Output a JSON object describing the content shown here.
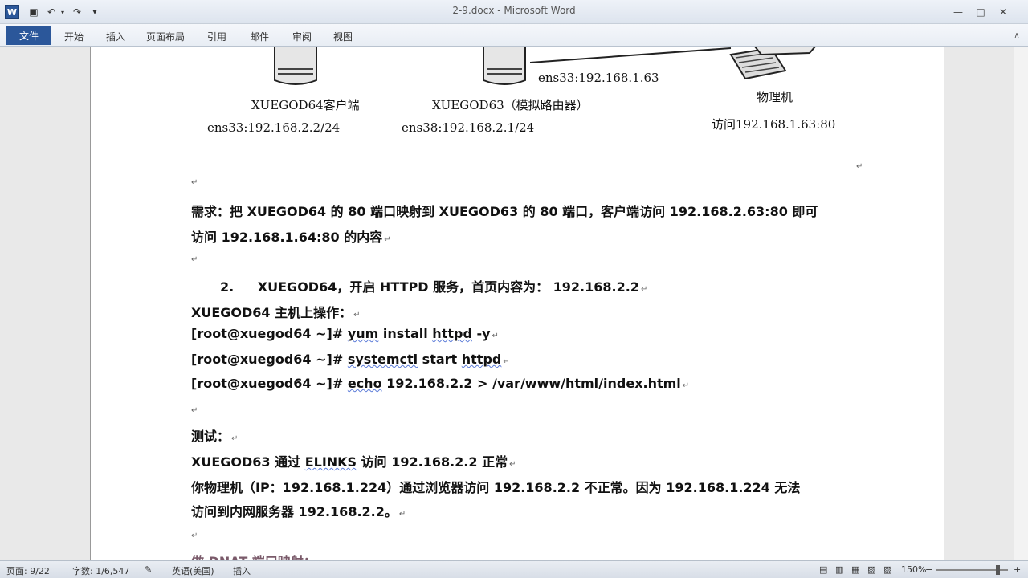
{
  "window": {
    "title": "2-9.docx - Microsoft Word",
    "app_icon_letter": "W"
  },
  "quick_access": {
    "save": "▣",
    "undo": "↶",
    "undo_dropdown": "▾",
    "redo": "↷",
    "customize": "▾"
  },
  "window_controls": {
    "minimize": "—",
    "maximize": "□",
    "close": "✕"
  },
  "ribbon": {
    "tabs": [
      "文件",
      "开始",
      "插入",
      "页面布局",
      "引用",
      "邮件",
      "审阅",
      "视图"
    ]
  },
  "diagram": {
    "client_label": "XUEGOD64客户端",
    "client_ip": "ens33:192.168.2.2/24",
    "router_label": "XUEGOD63（模拟路由器）",
    "router_ip_inner": "ens38:192.168.2.1/24",
    "router_ip_outer": "ens33:192.168.1.63",
    "physical_label": "物理机",
    "physical_access": "访问192.168.1.63:80"
  },
  "content": {
    "req_line1": "需求：把 XUEGOD64 的 80 端口映射到 XUEGOD63 的 80 端口，客户端访问 192.168.2.63:80  即可",
    "req_line2": "访问 192.168.1.64:80 的内容",
    "step2_num": "2.",
    "step2_text": "XUEGOD64，开启 HTTPD 服务，首页内容为：  192.168.2.2",
    "op_title": "XUEGOD64 主机上操作：",
    "cmd1_prompt": "[root@xuegod64 ~]#",
    "cmd1_a": "yum",
    "cmd1_b": " install  ",
    "cmd1_c": "httpd",
    "cmd1_d": "  -y",
    "cmd2_prompt": "[root@xuegod64 ~]#",
    "cmd2_a": "systemctl",
    "cmd2_b": "  start  ",
    "cmd2_c": "httpd",
    "cmd3_prompt": "[root@xuegod64 ~]#",
    "cmd3_a": "echo",
    "cmd3_b": " 192.168.2.2  > /var/www/html/index.html",
    "test_title": "测试：",
    "test_line1_a": "XUEGOD63  通过 ",
    "test_line1_b": "ELINKS",
    "test_line1_c": "   访问 192.168.2.2 正常",
    "test_line2": "你物理机（IP：192.168.1.224）通过浏览器访问 192.168.2.2 不正常。因为 192.168.1.224 无法",
    "test_line3": "访问到内网服务器 192.168.2.2。",
    "next_heading": "做 DNAT 端口映射："
  },
  "statusbar": {
    "page": "页面: 9/22",
    "words": "字数: 1/6,547",
    "language": "英语(美国)",
    "mode": "插入",
    "zoom": "150%",
    "zoom_level_percent": 150
  },
  "colors": {
    "accent": "#2b579a",
    "page_bg": "#ffffff",
    "workspace_bg": "#e9e9e9"
  }
}
